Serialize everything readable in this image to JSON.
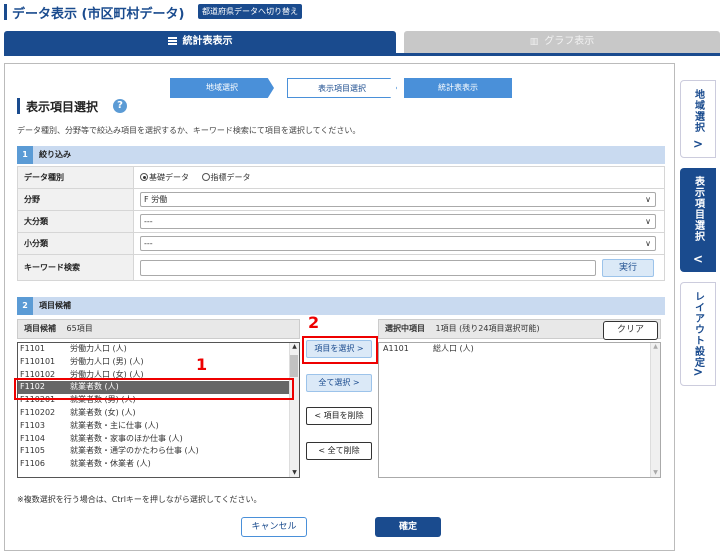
{
  "header": {
    "title": "データ表示 (市区町村データ)",
    "switch_button": "都道府県データへ切り替え"
  },
  "tabs": [
    {
      "label": "統計表表示",
      "icon": "list-icon",
      "active": true
    },
    {
      "label": "グラフ表示",
      "icon": "chart-icon",
      "active": false
    }
  ],
  "steps": [
    "地域選択",
    "表示項目選択",
    "統計表表示"
  ],
  "section": {
    "title": "表示項目選択",
    "help": "?",
    "description": "データ種別、分野等で絞込み項目を選択するか、キーワード検索にて項目を選択してください。"
  },
  "filter": {
    "number": "1",
    "title": "絞り込み",
    "data_type_label": "データ種別",
    "data_type_options": [
      "基礎データ",
      "指標データ"
    ],
    "data_type_selected": "基礎データ",
    "field_label": "分野",
    "field_value": "F 労働",
    "major_label": "大分類",
    "major_value": "---",
    "minor_label": "小分類",
    "minor_value": "---",
    "keyword_label": "キーワード検索",
    "keyword_value": "",
    "exec_button": "実行"
  },
  "candidates": {
    "number": "2",
    "title": "項目候補",
    "box_label": "項目候補",
    "count": "65項目",
    "items": [
      {
        "code": "F1101",
        "name": "労働力人口 (人)"
      },
      {
        "code": "F110101",
        "name": "労働力人口 (男) (人)"
      },
      {
        "code": "F110102",
        "name": "労働力人口 (女) (人)"
      },
      {
        "code": "F1102",
        "name": "就業者数 (人)"
      },
      {
        "code": "F110201",
        "name": "就業者数 (男) (人)"
      },
      {
        "code": "F110202",
        "name": "就業者数 (女) (人)"
      },
      {
        "code": "F1103",
        "name": "就業者数・主に仕事 (人)"
      },
      {
        "code": "F1104",
        "name": "就業者数・家事のほか仕事 (人)"
      },
      {
        "code": "F1105",
        "name": "就業者数・通学のかたわら仕事 (人)"
      },
      {
        "code": "F1106",
        "name": "就業者数・休業者 (人)"
      }
    ],
    "selected_index": 3
  },
  "actions": {
    "select_item": "項目を選択",
    "select_all": "全て選択",
    "delete_item": "項目を削除",
    "delete_all": "全て削除"
  },
  "selected": {
    "box_label": "選択中項目",
    "count_text": "1項目 (残り24項目選択可能)",
    "clear_button": "クリア",
    "items": [
      {
        "code": "A1101",
        "name": "総人口 (人)"
      }
    ]
  },
  "footnote": "※複数選択を行う場合は、Ctrlキーを押しながら選択してください。",
  "footer": {
    "cancel": "キャンセル",
    "confirm": "確定"
  },
  "side_nav": [
    {
      "label": "地域選択",
      "active": false,
      "arrow": ">"
    },
    {
      "label": "表示項目選択",
      "active": true,
      "arrow": "<"
    },
    {
      "label": "レイアウト設定",
      "active": false,
      "arrow": ">"
    }
  ],
  "annotations": {
    "mark1": "1",
    "mark2": "2",
    "color": "#e00000"
  },
  "colors": {
    "brand": "#1a4b8e",
    "accent": "#4a90d9",
    "section_bg": "#c9daf0"
  }
}
